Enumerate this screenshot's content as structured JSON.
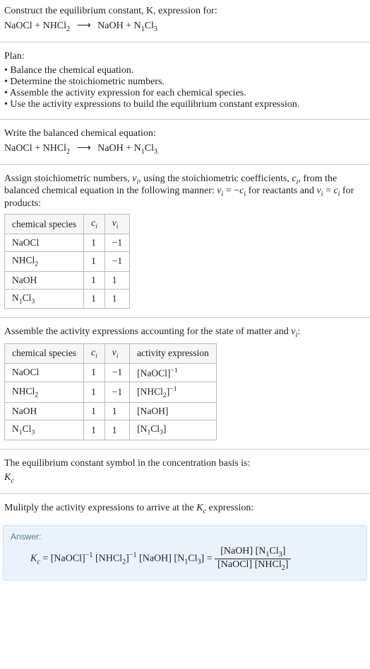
{
  "header": {
    "prompt_line1": "Construct the equilibrium constant, K, expression for:",
    "reaction_lhs1": "NaOCl",
    "reaction_plus": " + ",
    "reaction_lhs2": "NHCl",
    "reaction_lhs2_sub": "2",
    "reaction_arrow": "⟶",
    "reaction_rhs1": "NaOH",
    "reaction_rhs2": "N",
    "reaction_rhs2_sub1": "1",
    "reaction_rhs2_mid": "Cl",
    "reaction_rhs2_sub2": "3"
  },
  "plan": {
    "title": "Plan:",
    "items": [
      "Balance the chemical equation.",
      "Determine the stoichiometric numbers.",
      "Assemble the activity expression for each chemical species.",
      "Use the activity expressions to build the equilibrium constant expression."
    ]
  },
  "balanced": {
    "title": "Write the balanced chemical equation:"
  },
  "assign": {
    "text1": "Assign stoichiometric numbers, ",
    "nu": "ν",
    "sub_i": "i",
    "text2": ", using the stoichiometric coefficients, ",
    "c": "c",
    "text3": ", from the balanced chemical equation in the following manner: ",
    "eq1_lhs": "ν",
    "eq1_eq": " = −",
    "eq1_rhs": "c",
    "text4": " for reactants and ",
    "eq2_lhs": "ν",
    "eq2_eq": " = ",
    "eq2_rhs": "c",
    "text5": " for products:"
  },
  "table1": {
    "h1": "chemical species",
    "h2": "c",
    "h2_sub": "i",
    "h3": "ν",
    "h3_sub": "i",
    "rows": [
      {
        "sp": "NaOCl",
        "c": "1",
        "nu": "−1"
      },
      {
        "sp": "NHCl",
        "sp_sub": "2",
        "c": "1",
        "nu": "−1"
      },
      {
        "sp": "NaOH",
        "c": "1",
        "nu": "1"
      },
      {
        "sp": "N",
        "sp_sub1": "1",
        "sp_mid": "Cl",
        "sp_sub2": "3",
        "c": "1",
        "nu": "1"
      }
    ]
  },
  "assemble": {
    "text1": "Assemble the activity expressions accounting for the state of matter and ",
    "nu": "ν",
    "sub_i": "i",
    "text2": ":"
  },
  "table2": {
    "h1": "chemical species",
    "h2": "c",
    "h2_sub": "i",
    "h3": "ν",
    "h3_sub": "i",
    "h4": "activity expression",
    "rows": [
      {
        "sp": "NaOCl",
        "c": "1",
        "nu": "−1",
        "act_base": "[NaOCl]",
        "act_sup": "−1"
      },
      {
        "sp": "NHCl",
        "sp_sub": "2",
        "c": "1",
        "nu": "−1",
        "act_base": "[NHCl",
        "act_base_sub": "2",
        "act_base_close": "]",
        "act_sup": "−1"
      },
      {
        "sp": "NaOH",
        "c": "1",
        "nu": "1",
        "act_base": "[NaOH]"
      },
      {
        "sp": "N",
        "sp_sub1": "1",
        "sp_mid": "Cl",
        "sp_sub2": "3",
        "c": "1",
        "nu": "1",
        "act_base": "[N",
        "act_base_sub1": "1",
        "act_base_mid": "Cl",
        "act_base_sub2": "3",
        "act_base_close": "]"
      }
    ]
  },
  "symbol": {
    "text": "The equilibrium constant symbol in the concentration basis is:",
    "kc": "K",
    "kc_sub": "c"
  },
  "multiply": {
    "text1": "Mulitply the activity expressions to arrive at the ",
    "kc": "K",
    "kc_sub": "c",
    "text2": " expression:"
  },
  "answer": {
    "label": "Answer:",
    "kc": "K",
    "kc_sub": "c",
    "eq": " = ",
    "t1": "[NaOCl]",
    "t1_sup": "−1",
    "t2_open": " [NHCl",
    "t2_sub": "2",
    "t2_close": "]",
    "t2_sup": "−1",
    "t3": " [NaOH] ",
    "t4_open": "[N",
    "t4_sub1": "1",
    "t4_mid": "Cl",
    "t4_sub2": "3",
    "t4_close": "]",
    "eq2": " = ",
    "num1": "[NaOH] ",
    "num2_open": "[N",
    "num2_sub1": "1",
    "num2_mid": "Cl",
    "num2_sub2": "3",
    "num2_close": "]",
    "den1": "[NaOCl] ",
    "den2_open": "[NHCl",
    "den2_sub": "2",
    "den2_close": "]"
  }
}
